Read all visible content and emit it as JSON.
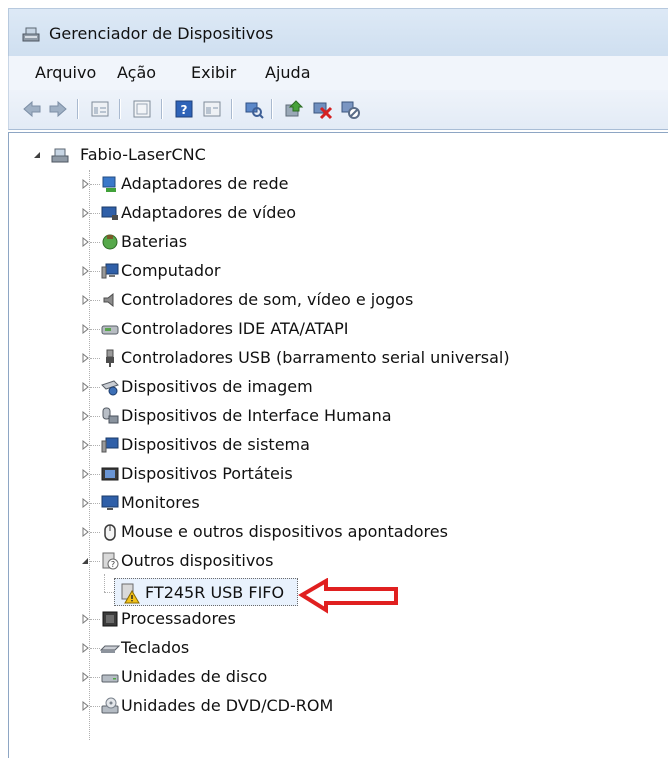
{
  "window": {
    "title": "Gerenciador de Dispositivos"
  },
  "menu": [
    "Arquivo",
    "Ação",
    "Exibir",
    "Ajuda"
  ],
  "tree": {
    "root": "Fabio-LaserCNC",
    "categories": [
      {
        "label": "Adaptadores de rede",
        "icon": "network-adapter-icon"
      },
      {
        "label": "Adaptadores de vídeo",
        "icon": "display-adapter-icon"
      },
      {
        "label": "Baterias",
        "icon": "battery-icon"
      },
      {
        "label": "Computador",
        "icon": "computer-icon"
      },
      {
        "label": "Controladores de som, vídeo e jogos",
        "icon": "speaker-icon"
      },
      {
        "label": "Controladores IDE ATA/ATAPI",
        "icon": "ide-controller-icon"
      },
      {
        "label": "Controladores USB (barramento serial universal)",
        "icon": "usb-plug-icon"
      },
      {
        "label": "Dispositivos de imagem",
        "icon": "scanner-camera-icon"
      },
      {
        "label": "Dispositivos de Interface Humana",
        "icon": "hid-icon"
      },
      {
        "label": "Dispositivos de sistema",
        "icon": "system-devices-icon"
      },
      {
        "label": "Dispositivos Portáteis",
        "icon": "portable-device-icon"
      },
      {
        "label": "Monitores",
        "icon": "monitor-icon"
      },
      {
        "label": "Mouse e outros dispositivos apontadores",
        "icon": "mouse-icon"
      },
      {
        "label": "Outros dispositivos",
        "icon": "unknown-device-icon",
        "expanded": true
      }
    ],
    "other_device_child": {
      "label": "FT245R USB FIFO",
      "icon": "warning-device-icon",
      "selected": true
    },
    "categories_after": [
      {
        "label": "Processadores",
        "icon": "processor-icon"
      },
      {
        "label": "Teclados",
        "icon": "keyboard-icon"
      },
      {
        "label": "Unidades de disco",
        "icon": "disk-drive-icon"
      },
      {
        "label": "Unidades de DVD/CD-ROM",
        "icon": "dvd-drive-icon"
      }
    ]
  },
  "annotation": {
    "arrow_color": "#e02020"
  }
}
